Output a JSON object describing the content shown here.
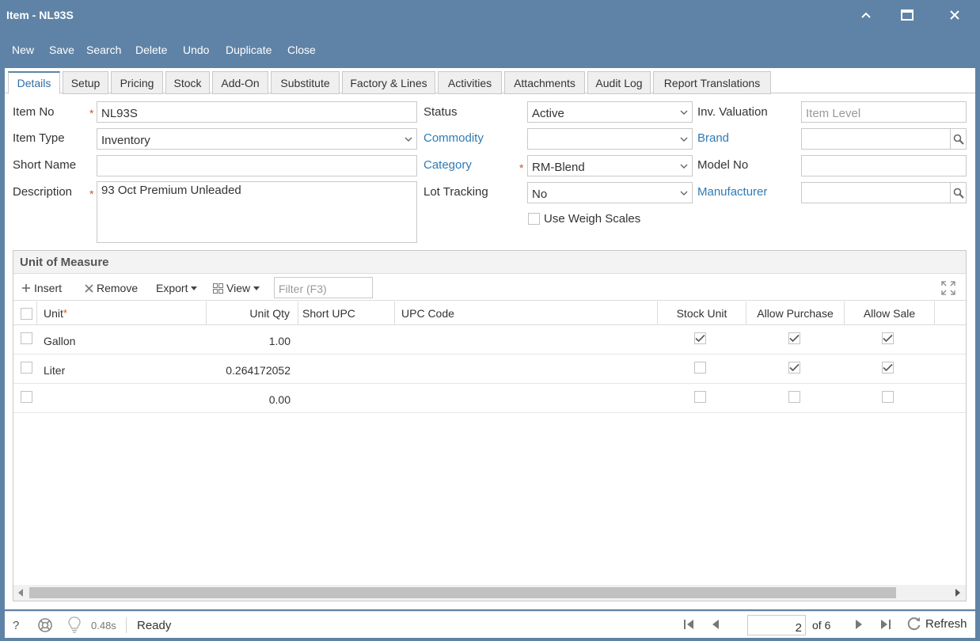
{
  "window": {
    "title": "Item - NL93S"
  },
  "toolbar": {
    "new": "New",
    "save": "Save",
    "search": "Search",
    "delete": "Delete",
    "undo": "Undo",
    "duplicate": "Duplicate",
    "close": "Close"
  },
  "tabs": [
    "Details",
    "Setup",
    "Pricing",
    "Stock",
    "Add-On",
    "Substitute",
    "Factory & Lines",
    "Activities",
    "Attachments",
    "Audit Log",
    "Report Translations"
  ],
  "form": {
    "item_no": {
      "label": "Item No",
      "value": "NL93S"
    },
    "item_type": {
      "label": "Item Type",
      "value": "Inventory"
    },
    "short_name": {
      "label": "Short Name",
      "value": ""
    },
    "description": {
      "label": "Description",
      "value": "93 Oct Premium Unleaded"
    },
    "status": {
      "label": "Status",
      "value": "Active"
    },
    "commodity": {
      "label": "Commodity",
      "value": ""
    },
    "category": {
      "label": "Category",
      "value": "RM-Blend"
    },
    "lot_tracking": {
      "label": "Lot Tracking",
      "value": "No"
    },
    "use_weigh_scales": {
      "label": "Use Weigh Scales",
      "checked": false
    },
    "inv_valuation": {
      "label": "Inv. Valuation",
      "value": "Item Level"
    },
    "brand": {
      "label": "Brand",
      "value": ""
    },
    "model_no": {
      "label": "Model No",
      "value": ""
    },
    "manufacturer": {
      "label": "Manufacturer",
      "value": ""
    },
    "required_marker": "*"
  },
  "uom_grid": {
    "title": "Unit of Measure",
    "insert": "Insert",
    "remove": "Remove",
    "export": "Export",
    "view": "View",
    "filter_placeholder": "Filter (F3)",
    "columns": {
      "unit": "Unit",
      "unit_qty": "Unit Qty",
      "short_upc": "Short UPC",
      "upc_code": "UPC Code",
      "stock_unit": "Stock Unit",
      "allow_purchase": "Allow Purchase",
      "allow_sale": "Allow Sale"
    },
    "rows": [
      {
        "unit": "Gallon",
        "unit_qty": "1.00",
        "stock_unit": true,
        "allow_purchase": true,
        "allow_sale": true
      },
      {
        "unit": "Liter",
        "unit_qty": "0.264172052",
        "stock_unit": false,
        "allow_purchase": true,
        "allow_sale": true
      },
      {
        "unit": "",
        "unit_qty": "0.00",
        "stock_unit": false,
        "allow_purchase": false,
        "allow_sale": false
      }
    ]
  },
  "status_bar": {
    "help": "?",
    "time": "0.48s",
    "status": "Ready",
    "page": "2",
    "of_pages": "of 6",
    "refresh": "Refresh"
  },
  "colors": {
    "titlebar": "#5f83a6",
    "link": "#2e7bb5",
    "required": "#d9531e"
  }
}
